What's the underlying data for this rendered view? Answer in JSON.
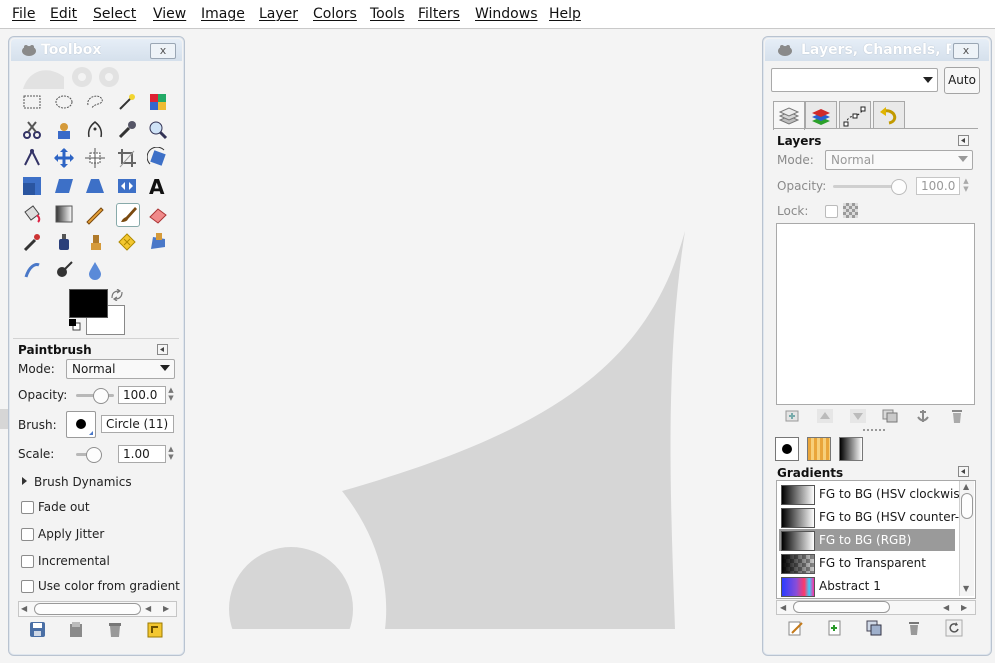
{
  "menubar": {
    "items": [
      "File",
      "Edit",
      "Select",
      "View",
      "Image",
      "Layer",
      "Colors",
      "Tools",
      "Filters",
      "Windows",
      "Help"
    ]
  },
  "toolbox": {
    "title": "Toolbox",
    "close_label": "x",
    "tool_options_title": "Paintbrush",
    "mode_label": "Mode:",
    "mode_value": "Normal",
    "opacity_label": "Opacity:",
    "opacity_value": "100.0",
    "brush_label": "Brush:",
    "brush_value": "Circle (11)",
    "scale_label": "Scale:",
    "scale_value": "1.00",
    "brush_dynamics": "Brush Dynamics",
    "options": [
      "Fade out",
      "Apply Jitter",
      "Incremental",
      "Use color from gradient"
    ],
    "fg_color": "#000000",
    "bg_color": "#ffffff",
    "tools": [
      "rect-select",
      "ellipse-select",
      "free-select",
      "fuzzy-select",
      "select-by-color",
      "scissors",
      "foreground-select",
      "paths",
      "color-picker",
      "zoom",
      "measure",
      "move",
      "align",
      "crop",
      "rotate",
      "scale",
      "shear",
      "perspective",
      "flip",
      "text",
      "bucket-fill",
      "blend",
      "pencil",
      "paintbrush",
      "eraser",
      "airbrush",
      "ink",
      "clone",
      "heal",
      "perspective-clone",
      "smudge",
      "dodge-burn",
      "blur-sharpen"
    ]
  },
  "layers_dock": {
    "title": "Layers, Channels, P",
    "close_label": "x",
    "auto_label": "Auto",
    "image_select_value": "",
    "tabs": [
      "layers-tab",
      "channels-tab",
      "paths-tab",
      "undo-tab"
    ],
    "layers_title": "Layers",
    "mode_label": "Mode:",
    "mode_value": "Normal",
    "opacity_label": "Opacity:",
    "opacity_value": "100.0",
    "lock_label": "Lock:",
    "gradients_title": "Gradients",
    "gradients": [
      {
        "name": "FG to BG (HSV clockwis",
        "selected": false
      },
      {
        "name": "FG to BG (HSV counter-",
        "selected": false
      },
      {
        "name": "FG to BG (RGB)",
        "selected": true
      },
      {
        "name": "FG to Transparent",
        "selected": false
      },
      {
        "name": "Abstract 1",
        "selected": false
      }
    ]
  },
  "colors": {
    "panel_bg": "#f3f3f3",
    "selection": "#9a9a9a",
    "logo_gray": "#d6d6d6"
  }
}
